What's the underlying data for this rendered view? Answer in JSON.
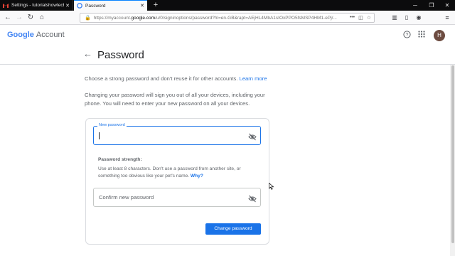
{
  "browser": {
    "tabs": [
      {
        "title": "Settings - tutorialshowtech@g",
        "icon": "gmail-icon"
      },
      {
        "title": "Password",
        "icon": "google-icon"
      }
    ],
    "url_prefix": "https://myaccount.",
    "url_domain": "google.com",
    "url_rest": "/u/0/signinoptions/password?hl=en-GB&rapt=AEjHL4MbA1sIOxPPO5fsMSP4HM1-ePj/..."
  },
  "header": {
    "logo_google": "Google",
    "logo_account": "Account",
    "avatar_initial": "H"
  },
  "page": {
    "title": "Password",
    "intro_text": "Choose a strong password and don't reuse it for other accounts.",
    "learn_more": "Learn more",
    "warning_text": "Changing your password will sign you out of all your devices, including your phone. You will need to enter your new password on all your devices."
  },
  "form": {
    "new_password_label": "New password",
    "new_password_value": "",
    "strength_heading": "Password strength:",
    "strength_text": "Use at least 8 characters. Don't use a password from another site, or something too obvious like your pet's name.",
    "why_link": "Why?",
    "confirm_placeholder": "Confirm new password",
    "submit_label": "Change password"
  },
  "colors": {
    "accent": "#1a73e8",
    "avatar": "#6d4c41"
  }
}
